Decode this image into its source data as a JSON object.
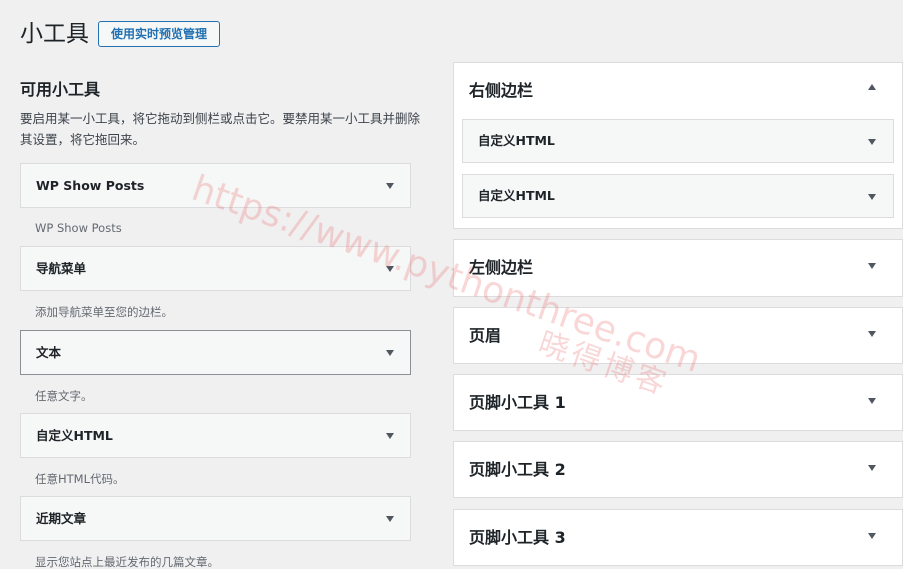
{
  "page": {
    "title": "小工具",
    "manage_button": "使用实时预览管理"
  },
  "available": {
    "title": "可用小工具",
    "description": "要启用某一小工具，将它拖动到侧栏或点击它。要禁用某一小工具并删除其设置，将它拖回来。",
    "widgets": [
      {
        "label": "WP Show Posts",
        "description": "WP Show Posts"
      },
      {
        "label": "导航菜单",
        "description": "添加导航菜单至您的边栏。"
      },
      {
        "label": "文本",
        "description": "任意文字。"
      },
      {
        "label": "自定义HTML",
        "description": "任意HTML代码。"
      },
      {
        "label": "近期文章",
        "description": "显示您站点上最近发布的几篇文章。"
      }
    ]
  },
  "areas": [
    {
      "title": "右侧边栏",
      "expanded": true,
      "widgets": [
        "自定义HTML",
        "自定义HTML"
      ]
    },
    {
      "title": "左侧边栏",
      "expanded": false
    },
    {
      "title": "页眉",
      "expanded": false
    },
    {
      "title": "页脚小工具 1",
      "expanded": false
    },
    {
      "title": "页脚小工具 2",
      "expanded": false
    },
    {
      "title": "页脚小工具 3",
      "expanded": false
    }
  ],
  "watermark": {
    "url": "https://www.pythonthree.com",
    "brand": "晓得博客"
  },
  "colors": {
    "background": "#f0f0f1",
    "accent": "#2271b1",
    "watermark": "#e86e6e"
  }
}
